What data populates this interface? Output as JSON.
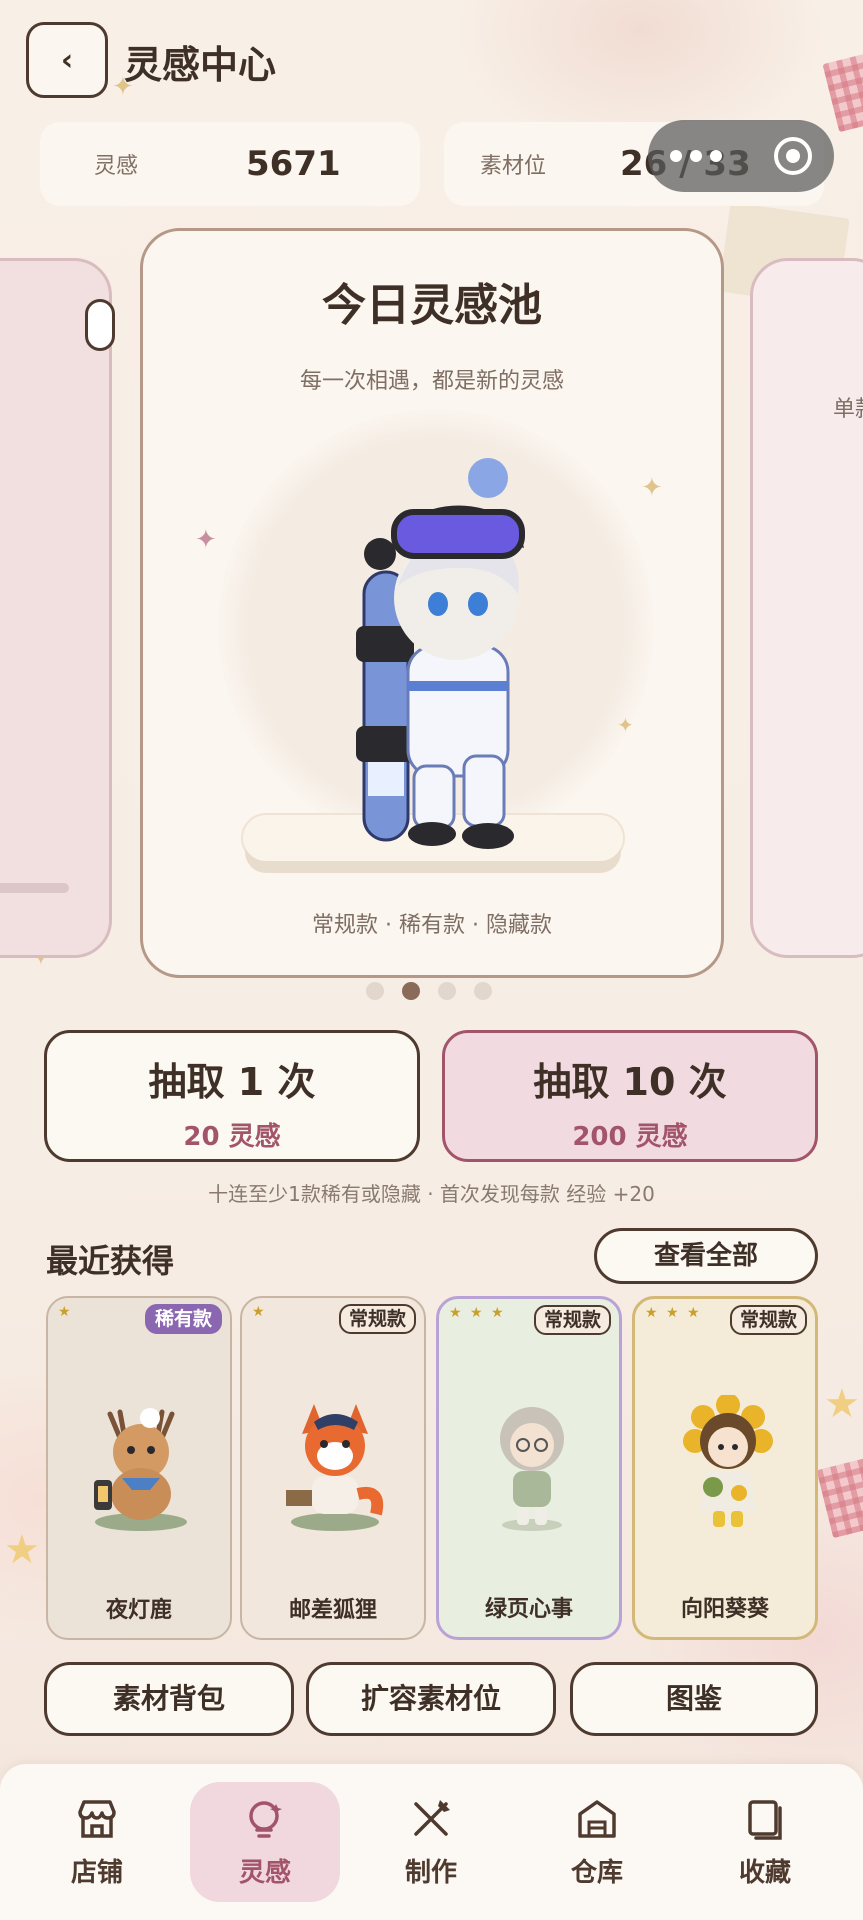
{
  "header": {
    "title": "灵感中心",
    "back_icon": "chevron-left-icon"
  },
  "stats": [
    {
      "label": "灵感",
      "value": "5671"
    },
    {
      "label": "素材位",
      "value": "26 / 33"
    }
  ],
  "pool": {
    "title": "今日灵感池",
    "subtitle": "每一次相遇，都是新的灵感",
    "footer": "常规款 · 稀有款 · 隐藏款",
    "right_card_text": "单款",
    "page_count": 4,
    "active_page": 2
  },
  "draw": {
    "single": {
      "title": "抽取 1 次",
      "cost": "20 灵感"
    },
    "ten": {
      "title": "抽取 10 次",
      "cost": "200 灵感"
    },
    "hint": "十连至少1款稀有或隐藏 · 首次发现每款 经验 +20"
  },
  "recent": {
    "title": "最近获得",
    "view_all": "查看全部",
    "items": [
      {
        "name": "夜灯鹿",
        "tag": "稀有款",
        "stars": "★",
        "bg": "#ece3d8",
        "border": "#c8b5a4"
      },
      {
        "name": "邮差狐狸",
        "tag": "常规款",
        "stars": "★",
        "bg": "#f1e7dc",
        "border": "#c8b5a4"
      },
      {
        "name": "绿页心事",
        "tag": "常规款",
        "stars": "★ ★ ★",
        "bg": "#e8eee0",
        "border": "#b9a3d6"
      },
      {
        "name": "向阳葵葵",
        "tag": "常规款",
        "stars": "★ ★ ★",
        "bg": "#f4ecd8",
        "border": "#d4b878"
      }
    ]
  },
  "actions": [
    "素材背包",
    "扩容素材位",
    "图鉴"
  ],
  "tabs": [
    {
      "label": "店铺",
      "icon": "store-icon"
    },
    {
      "label": "灵感",
      "icon": "lightbulb-icon"
    },
    {
      "label": "制作",
      "icon": "tools-icon"
    },
    {
      "label": "仓库",
      "icon": "warehouse-icon"
    },
    {
      "label": "收藏",
      "icon": "collection-icon"
    }
  ],
  "active_tab": 1,
  "colors": {
    "accent": "#a2556a",
    "ink": "#3f3027",
    "border": "#4e3a2f",
    "rare": "#8a67b0"
  }
}
